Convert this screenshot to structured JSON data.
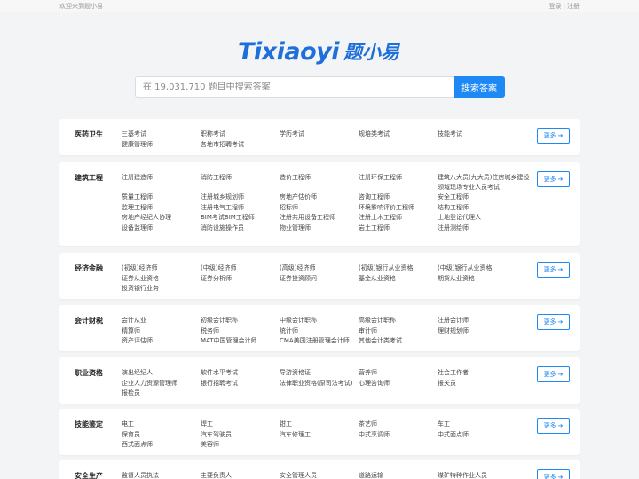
{
  "topbar": {
    "welcome": "欢迎来到题小易",
    "login": "登录",
    "separator": "|",
    "register": "注册"
  },
  "logo": {
    "latin": "Tixiaoyi",
    "cjk": "题小易"
  },
  "search": {
    "placeholder": "在 19,031,710 题目中搜索答案",
    "button": "搜索答案"
  },
  "more_label": "更多",
  "categories": [
    {
      "title": "医药卫生",
      "items": [
        "三基考试",
        "职称考试",
        "学历考试",
        "规培类考试",
        "技能考试",
        "健康管理师",
        "各地市招聘考试"
      ]
    },
    {
      "title": "建筑工程",
      "items": [
        "注册建造师",
        "消防工程师",
        "造价工程师",
        "注册环保工程师",
        "建筑八大员(九大员)住房城乡建设领域现场专业人员考试",
        "质量工程师",
        "注册城乡规划师",
        "房地产估价师",
        "咨询工程师",
        "安全工程师",
        "监理工程师",
        "注册电气工程师",
        "招标师",
        "环境影响评价工程师",
        "结构工程师",
        "房地产经纪人协理",
        "BIM考试BIM工程师",
        "注册共用设备工程师",
        "注册土木工程师",
        "土地登记代理人",
        "设备监理师",
        "消防设施操作员",
        "物业管理师",
        "岩土工程师",
        "注册测绘师"
      ]
    },
    {
      "title": "经济金融",
      "items": [
        "(初级)经济师",
        "(中级)经济师",
        "(高级)经济师",
        "(初级)银行从业资格",
        "(中级)银行从业资格",
        "证券从业资格",
        "证券分析师",
        "证券投资顾问",
        "基金从业资格",
        "期货从业资格",
        "投资银行业务"
      ]
    },
    {
      "title": "会计财税",
      "items": [
        "会计从业",
        "初级会计职称",
        "中级会计职称",
        "高级会计职称",
        "注册会计师",
        "精算师",
        "税务师",
        "统计师",
        "审计师",
        "理财规划师",
        "资产评估师",
        "MAT中国管理会计师",
        "CMA美国注册管理会计师",
        "其他会计类考试"
      ]
    },
    {
      "title": "职业资格",
      "items": [
        "演出经纪人",
        "软件水平考试",
        "导游资格证",
        "营养师",
        "社会工作者",
        "企业人力资源管理师",
        "银行招聘考试",
        "法律职业资格(原司法考试)",
        "心理咨询师",
        "报关员",
        "报检员"
      ]
    },
    {
      "title": "技能鉴定",
      "items": [
        "电工",
        "焊工",
        "钳工",
        "茶艺师",
        "车工",
        "保育员",
        "汽车驾驶员",
        "汽车修理工",
        "中式烹调师",
        "中式面点师",
        "西式面点师",
        "美容师"
      ]
    },
    {
      "title": "安全生产",
      "items": [
        "监督人员执法",
        "主要负责人",
        "安全管理人员",
        "道路运输",
        "煤矿特种作业人员"
      ]
    }
  ]
}
